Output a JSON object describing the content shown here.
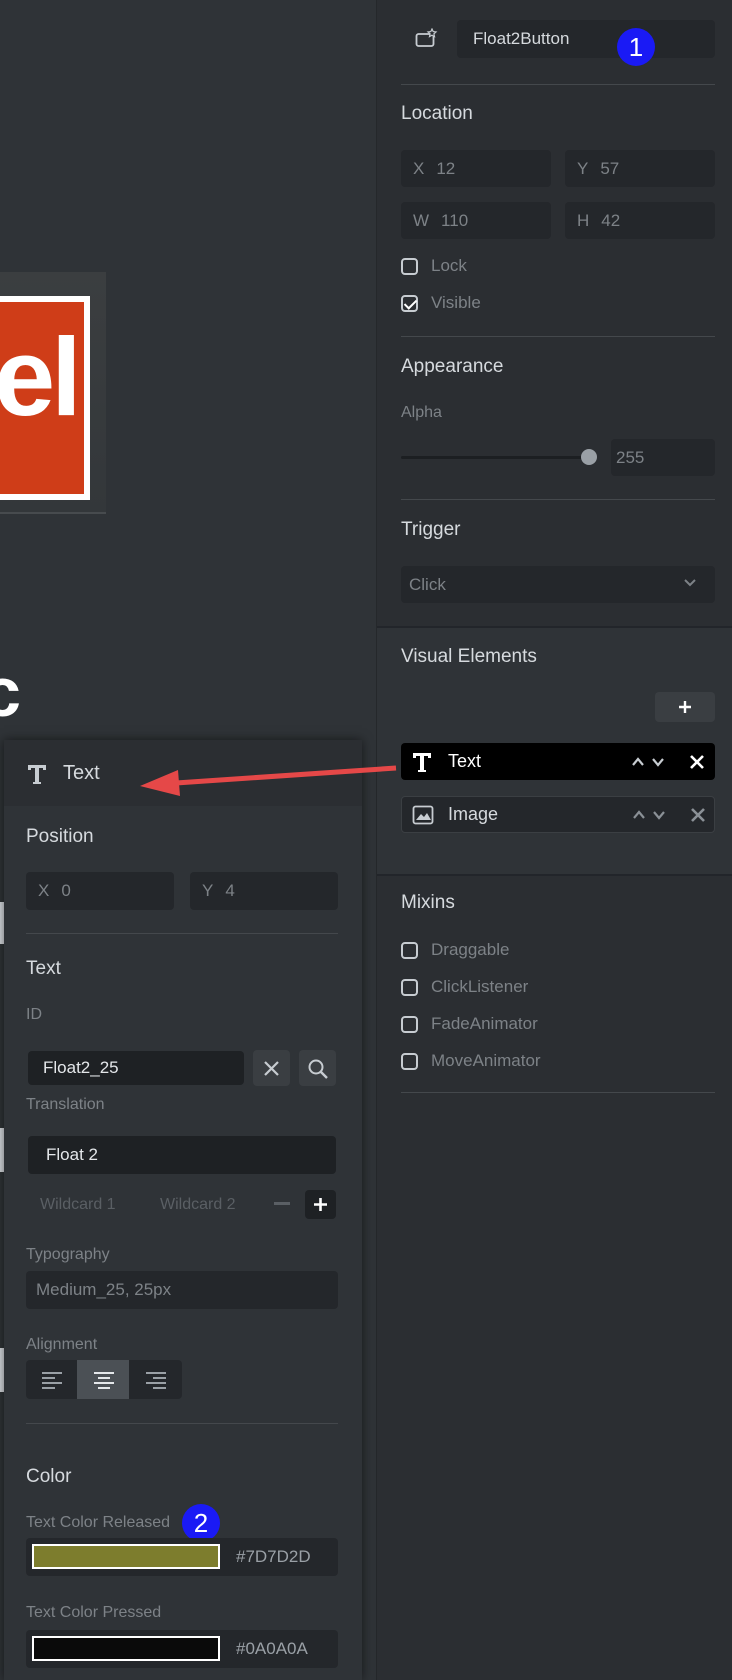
{
  "header": {
    "component_name": "Float2Button",
    "badge": "1"
  },
  "location": {
    "title": "Location",
    "x_label": "X",
    "x_value": "12",
    "y_label": "Y",
    "y_value": "57",
    "w_label": "W",
    "w_value": "110",
    "h_label": "H",
    "h_value": "42",
    "lock_label": "Lock",
    "lock_checked": false,
    "visible_label": "Visible",
    "visible_checked": true
  },
  "appearance": {
    "title": "Appearance",
    "alpha_label": "Alpha",
    "alpha_value": "255",
    "alpha_fraction": 1.0
  },
  "trigger": {
    "title": "Trigger",
    "selected": "Click"
  },
  "visual_elements": {
    "title": "Visual Elements",
    "items": [
      {
        "label": "Text",
        "icon": "text-icon",
        "selected": true
      },
      {
        "label": "Image",
        "icon": "image-icon",
        "selected": false
      }
    ]
  },
  "mixins": {
    "title": "Mixins",
    "items": [
      {
        "label": "Draggable",
        "checked": false
      },
      {
        "label": "ClickListener",
        "checked": false
      },
      {
        "label": "FadeAnimator",
        "checked": false
      },
      {
        "label": "MoveAnimator",
        "checked": false
      }
    ]
  },
  "text_inspector": {
    "title": "Text",
    "position": {
      "title": "Position",
      "x_label": "X",
      "x_value": "0",
      "y_label": "Y",
      "y_value": "4"
    },
    "text": {
      "title": "Text",
      "id_label": "ID",
      "id_value": "Float2_25",
      "translation_label": "Translation",
      "translation_value": "Float 2",
      "wildcard1": "Wildcard 1",
      "wildcard2": "Wildcard 2",
      "typography_label": "Typography",
      "typography_value": "Medium_25, 25px",
      "alignment_label": "Alignment",
      "alignment_selected": "center"
    },
    "color": {
      "title": "Color",
      "released_label": "Text Color Released",
      "released_hex": "#7D7D2D",
      "released_color": "#7d7d2d",
      "pressed_label": "Text Color Pressed",
      "pressed_hex": "#0A0A0A",
      "pressed_color": "#0a0a0a",
      "badge": "2"
    }
  },
  "canvas": {
    "preview_letters": "el",
    "preview_letter2": "c"
  },
  "colors": {
    "arrow": "#e54848",
    "badge": "#1a1af5",
    "accent_orange": "#cf3d18"
  }
}
